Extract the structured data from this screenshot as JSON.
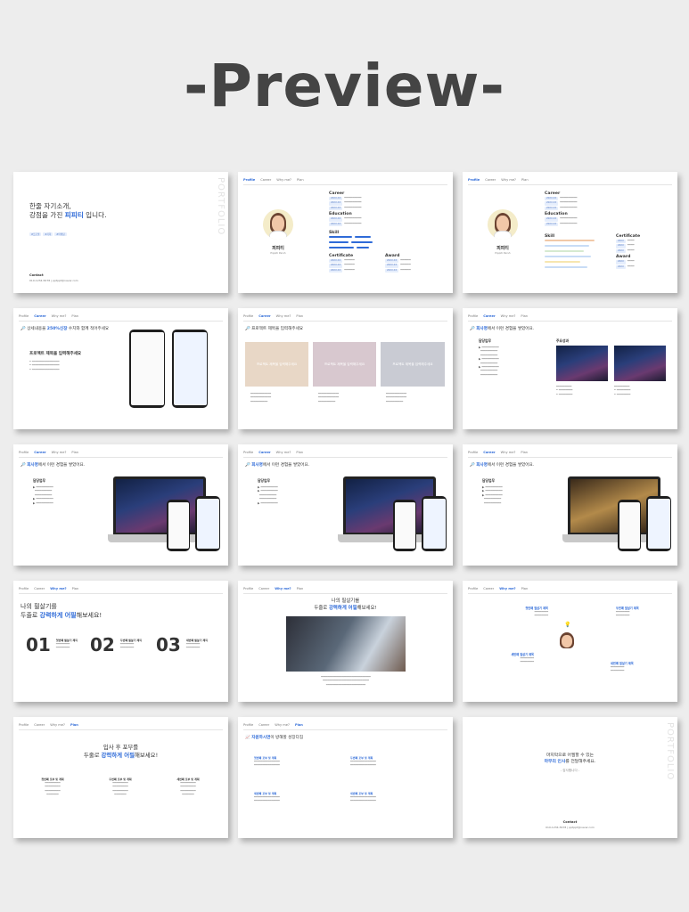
{
  "title": "-Preview-",
  "nav": [
    "Profile",
    "Career",
    "Why me?",
    "Plan"
  ],
  "cover": {
    "line1": "한줄 자기소개,",
    "line2_prefix": "강점을 가진 ",
    "line2_highlight": "피피티",
    "line2_suffix": " 입니다.",
    "tags": [
      "#프로필",
      "#기획",
      "#마케팅"
    ],
    "side_text": "PORTFOLIO",
    "contact_label": "Contact",
    "contact_info": "010-1234-5678 | pptppt@naver.com"
  },
  "profile": {
    "name": "피피티",
    "name_en": "Pippiti Parsh",
    "career_heading": "Career",
    "education_heading": "Education",
    "skill_heading": "Skill",
    "certificate_heading": "Certificate",
    "award_heading": "Award"
  },
  "career_intro": {
    "heading_prefix": "상세내용을 ",
    "heading_highlight": "250%신장",
    "heading_suffix": " 수치와 함께 적어주세요",
    "project_title": "프로젝트 제목을 입력해주세요"
  },
  "career_projects": {
    "heading": "프로젝트 제목을 입력해주세요",
    "card_title": "프로젝트 제목을 입력해주세요"
  },
  "career_experience": {
    "heading_highlight": "회사명",
    "heading_suffix": "에서 이런 경험을 쌓았어요.",
    "col1": "담당업무",
    "col2": "주요성과"
  },
  "whyme1": {
    "line1": "나의 필살기를",
    "line2_prefix": "두줄로 ",
    "line2_highlight": "강력하게 어필",
    "line2_suffix": "해보세요!",
    "items": [
      {
        "num": "01",
        "title": "첫번째 필살기 제목"
      },
      {
        "num": "02",
        "title": "두번째 필살기 제목"
      },
      {
        "num": "03",
        "title": "세번째 필살기 제목"
      }
    ]
  },
  "whyme2": {
    "line1": "나의 필살기를",
    "line2_prefix": "두줄로 ",
    "line2_highlight": "강력하게 어필",
    "line2_suffix": "해보세요!"
  },
  "whyme3": {
    "items": [
      "첫번째 필살기 제목",
      "두번째 필살기 제목",
      "세번째 필살기 제목",
      "네번째 필살기 제목"
    ]
  },
  "plan1": {
    "line1": "입사 후 포부를",
    "line2_prefix": "두줄로 ",
    "line2_highlight": "강력하게 어필",
    "line2_suffix": "해보세요!",
    "cols": [
      "첫번째 포부 및 계획",
      "두번째 포부 및 계획",
      "세번째 포부 및 계획"
    ]
  },
  "plan2": {
    "heading_highlight": "자원하시면",
    "heading_suffix": "이 방해할 성장다짐",
    "items": [
      "첫번째 포부 및 계획",
      "두번째 포부 및 계획",
      "세번째 포부 및 계획",
      "네번째 포부 및 계획"
    ]
  },
  "closing": {
    "line1": "마지막으로 어필할 수 있는",
    "line2_highlight": "마무리 인사",
    "line2_suffix": "를 전달해주세요.",
    "line3": "- 감사합니다 -",
    "side_text": "PORTFOLIO",
    "contact_label": "Contact",
    "contact_info": "010-1234-5678 | pptppt@naver.com"
  },
  "colors": {
    "accent": "#2f6bd8",
    "title": "#444444",
    "background": "#ededed"
  }
}
